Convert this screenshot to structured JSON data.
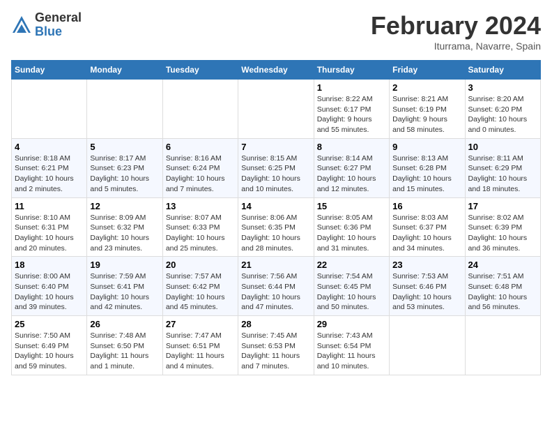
{
  "header": {
    "logo_general": "General",
    "logo_blue": "Blue",
    "title": "February 2024",
    "location": "Iturrama, Navarre, Spain"
  },
  "calendar": {
    "weekdays": [
      "Sunday",
      "Monday",
      "Tuesday",
      "Wednesday",
      "Thursday",
      "Friday",
      "Saturday"
    ],
    "rows": [
      [
        {
          "day": "",
          "info": ""
        },
        {
          "day": "",
          "info": ""
        },
        {
          "day": "",
          "info": ""
        },
        {
          "day": "",
          "info": ""
        },
        {
          "day": "1",
          "info": "Sunrise: 8:22 AM\nSunset: 6:17 PM\nDaylight: 9 hours\nand 55 minutes."
        },
        {
          "day": "2",
          "info": "Sunrise: 8:21 AM\nSunset: 6:19 PM\nDaylight: 9 hours\nand 58 minutes."
        },
        {
          "day": "3",
          "info": "Sunrise: 8:20 AM\nSunset: 6:20 PM\nDaylight: 10 hours\nand 0 minutes."
        }
      ],
      [
        {
          "day": "4",
          "info": "Sunrise: 8:18 AM\nSunset: 6:21 PM\nDaylight: 10 hours\nand 2 minutes."
        },
        {
          "day": "5",
          "info": "Sunrise: 8:17 AM\nSunset: 6:23 PM\nDaylight: 10 hours\nand 5 minutes."
        },
        {
          "day": "6",
          "info": "Sunrise: 8:16 AM\nSunset: 6:24 PM\nDaylight: 10 hours\nand 7 minutes."
        },
        {
          "day": "7",
          "info": "Sunrise: 8:15 AM\nSunset: 6:25 PM\nDaylight: 10 hours\nand 10 minutes."
        },
        {
          "day": "8",
          "info": "Sunrise: 8:14 AM\nSunset: 6:27 PM\nDaylight: 10 hours\nand 12 minutes."
        },
        {
          "day": "9",
          "info": "Sunrise: 8:13 AM\nSunset: 6:28 PM\nDaylight: 10 hours\nand 15 minutes."
        },
        {
          "day": "10",
          "info": "Sunrise: 8:11 AM\nSunset: 6:29 PM\nDaylight: 10 hours\nand 18 minutes."
        }
      ],
      [
        {
          "day": "11",
          "info": "Sunrise: 8:10 AM\nSunset: 6:31 PM\nDaylight: 10 hours\nand 20 minutes."
        },
        {
          "day": "12",
          "info": "Sunrise: 8:09 AM\nSunset: 6:32 PM\nDaylight: 10 hours\nand 23 minutes."
        },
        {
          "day": "13",
          "info": "Sunrise: 8:07 AM\nSunset: 6:33 PM\nDaylight: 10 hours\nand 25 minutes."
        },
        {
          "day": "14",
          "info": "Sunrise: 8:06 AM\nSunset: 6:35 PM\nDaylight: 10 hours\nand 28 minutes."
        },
        {
          "day": "15",
          "info": "Sunrise: 8:05 AM\nSunset: 6:36 PM\nDaylight: 10 hours\nand 31 minutes."
        },
        {
          "day": "16",
          "info": "Sunrise: 8:03 AM\nSunset: 6:37 PM\nDaylight: 10 hours\nand 34 minutes."
        },
        {
          "day": "17",
          "info": "Sunrise: 8:02 AM\nSunset: 6:39 PM\nDaylight: 10 hours\nand 36 minutes."
        }
      ],
      [
        {
          "day": "18",
          "info": "Sunrise: 8:00 AM\nSunset: 6:40 PM\nDaylight: 10 hours\nand 39 minutes."
        },
        {
          "day": "19",
          "info": "Sunrise: 7:59 AM\nSunset: 6:41 PM\nDaylight: 10 hours\nand 42 minutes."
        },
        {
          "day": "20",
          "info": "Sunrise: 7:57 AM\nSunset: 6:42 PM\nDaylight: 10 hours\nand 45 minutes."
        },
        {
          "day": "21",
          "info": "Sunrise: 7:56 AM\nSunset: 6:44 PM\nDaylight: 10 hours\nand 47 minutes."
        },
        {
          "day": "22",
          "info": "Sunrise: 7:54 AM\nSunset: 6:45 PM\nDaylight: 10 hours\nand 50 minutes."
        },
        {
          "day": "23",
          "info": "Sunrise: 7:53 AM\nSunset: 6:46 PM\nDaylight: 10 hours\nand 53 minutes."
        },
        {
          "day": "24",
          "info": "Sunrise: 7:51 AM\nSunset: 6:48 PM\nDaylight: 10 hours\nand 56 minutes."
        }
      ],
      [
        {
          "day": "25",
          "info": "Sunrise: 7:50 AM\nSunset: 6:49 PM\nDaylight: 10 hours\nand 59 minutes."
        },
        {
          "day": "26",
          "info": "Sunrise: 7:48 AM\nSunset: 6:50 PM\nDaylight: 11 hours\nand 1 minute."
        },
        {
          "day": "27",
          "info": "Sunrise: 7:47 AM\nSunset: 6:51 PM\nDaylight: 11 hours\nand 4 minutes."
        },
        {
          "day": "28",
          "info": "Sunrise: 7:45 AM\nSunset: 6:53 PM\nDaylight: 11 hours\nand 7 minutes."
        },
        {
          "day": "29",
          "info": "Sunrise: 7:43 AM\nSunset: 6:54 PM\nDaylight: 11 hours\nand 10 minutes."
        },
        {
          "day": "",
          "info": ""
        },
        {
          "day": "",
          "info": ""
        }
      ]
    ]
  }
}
